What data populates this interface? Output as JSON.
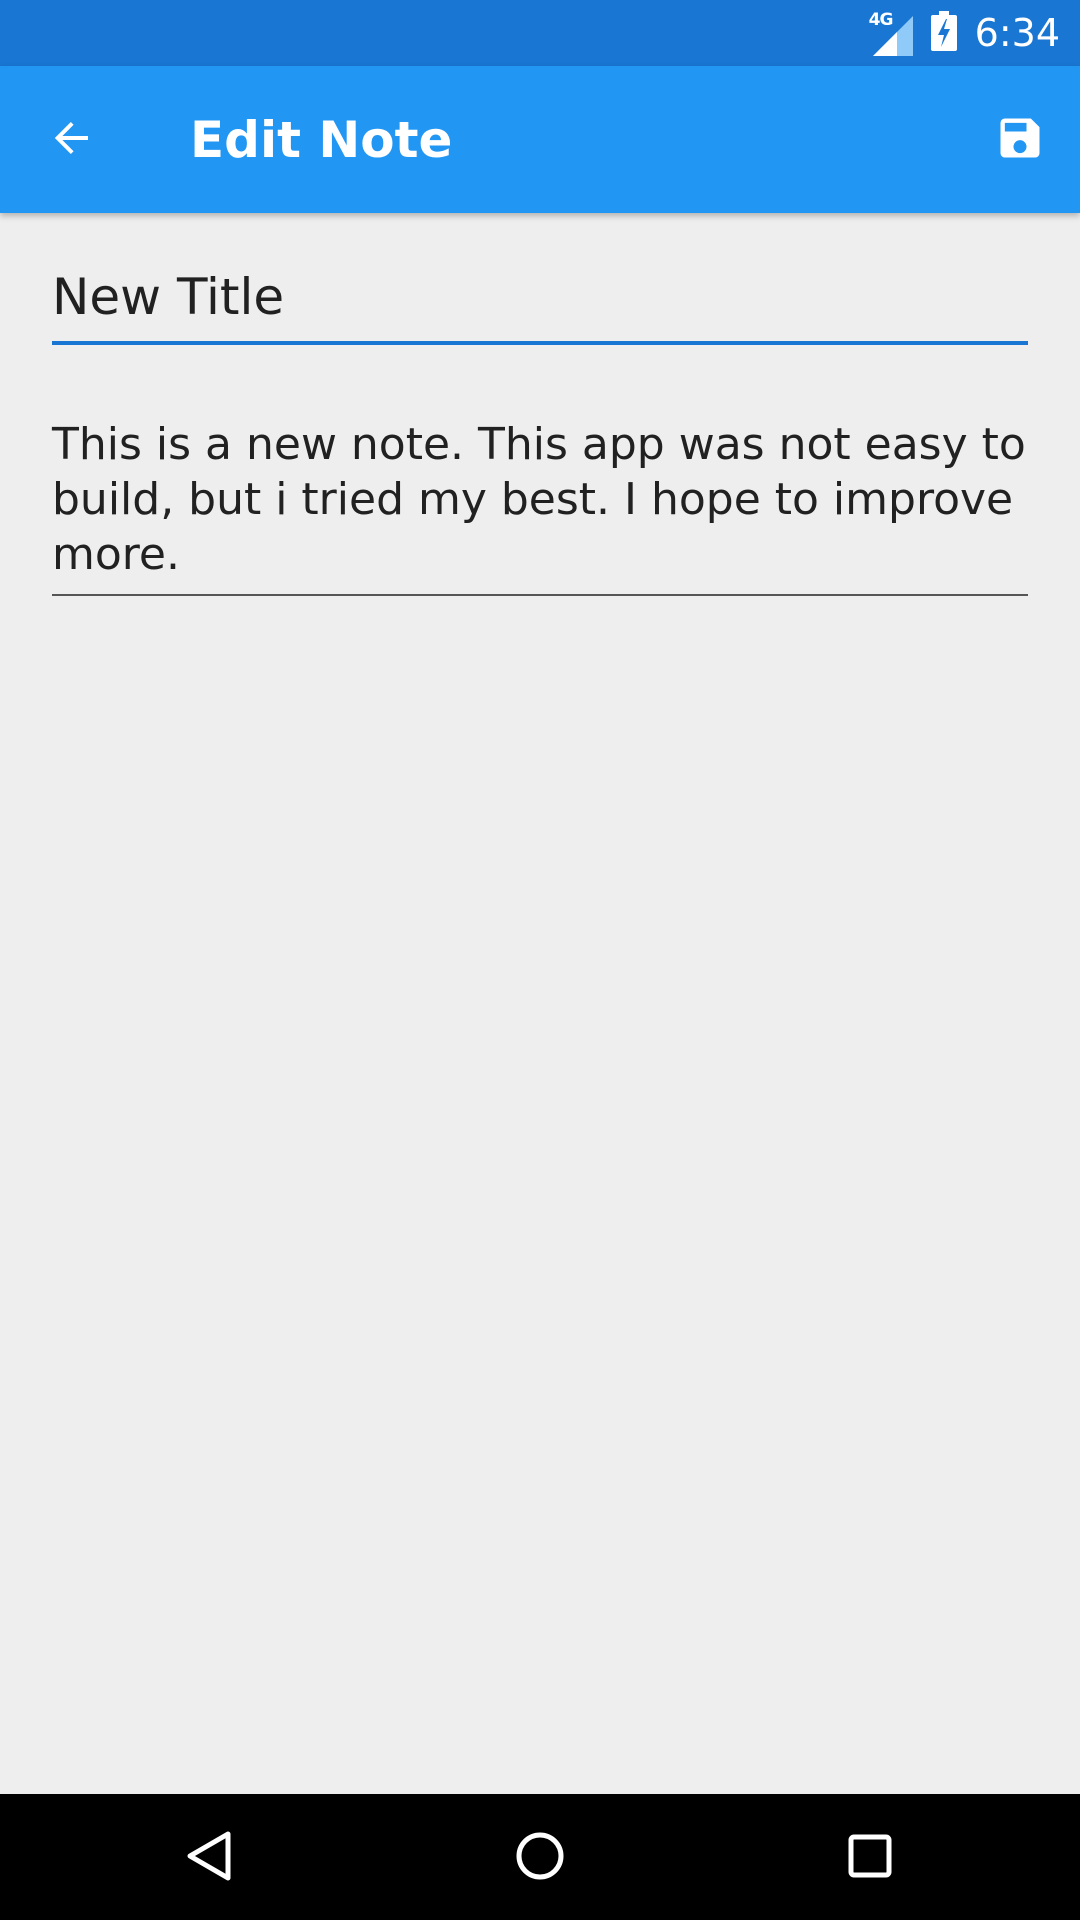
{
  "status_bar": {
    "network": "4G",
    "time": "6:34",
    "icons": [
      "signal-icon",
      "battery-charging-icon"
    ]
  },
  "app_bar": {
    "title": "Edit Note",
    "back_icon": "arrow-back-icon",
    "save_icon": "save-icon"
  },
  "note": {
    "title": "New Title",
    "body": "This is a new note. This app was not easy to build, but i tried my best. I hope to improve more."
  },
  "nav_bar": {
    "icons": [
      "back-triangle-icon",
      "home-circle-icon",
      "recents-square-icon"
    ]
  },
  "colors": {
    "status_bar": "#1976d2",
    "app_bar": "#2196f3",
    "background": "#eeeeee",
    "accent": "#1976d2",
    "nav_bar": "#000000"
  }
}
